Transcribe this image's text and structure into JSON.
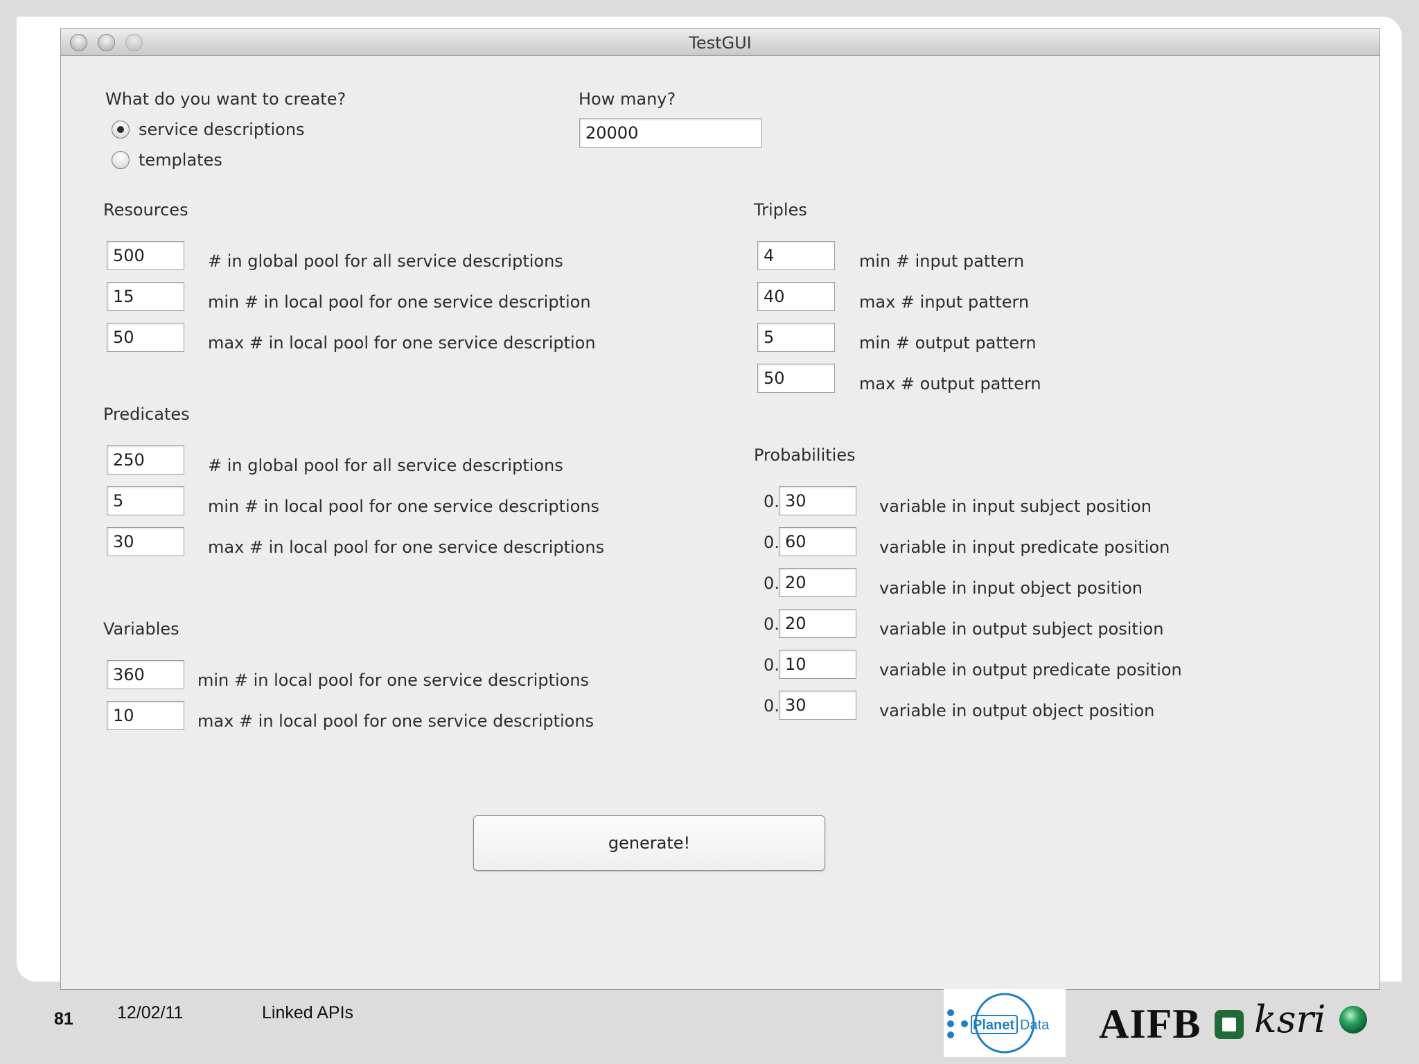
{
  "window": {
    "title": "TestGUI"
  },
  "create": {
    "question": "What do you want to create?",
    "options": [
      "service descriptions",
      "templates"
    ],
    "selected": "service descriptions"
  },
  "how_many": {
    "label": "How many?",
    "value": "20000"
  },
  "resources": {
    "title": "Resources",
    "rows": [
      {
        "value": "500",
        "label": "# in global pool for all service descriptions"
      },
      {
        "value": "15",
        "label": "min # in local pool for one service description"
      },
      {
        "value": "50",
        "label": "max # in local pool for one service description"
      }
    ]
  },
  "predicates": {
    "title": "Predicates",
    "rows": [
      {
        "value": "250",
        "label": "# in global pool for all service descriptions"
      },
      {
        "value": "5",
        "label": "min # in local pool for one service descriptions"
      },
      {
        "value": "30",
        "label": "max # in local pool for one service descriptions"
      }
    ]
  },
  "variables": {
    "title": "Variables",
    "rows": [
      {
        "value": "360",
        "label": "min # in local pool for one service descriptions"
      },
      {
        "value": "10",
        "label": "max # in local pool for one service descriptions"
      }
    ]
  },
  "triples": {
    "title": "Triples",
    "rows": [
      {
        "value": "4",
        "label": "min # input pattern"
      },
      {
        "value": "40",
        "label": "max # input pattern"
      },
      {
        "value": "5",
        "label": "min # output pattern"
      },
      {
        "value": "50",
        "label": "max # output pattern"
      }
    ]
  },
  "probabilities": {
    "title": "Probabilities",
    "prefix": "0.",
    "rows": [
      {
        "value": "30",
        "label": "variable in input subject position"
      },
      {
        "value": "60",
        "label": "variable in input predicate position"
      },
      {
        "value": "20",
        "label": "variable in input object position"
      },
      {
        "value": "20",
        "label": "variable in output subject position"
      },
      {
        "value": "10",
        "label": "variable in output predicate position"
      },
      {
        "value": "30",
        "label": "variable in output object position"
      }
    ]
  },
  "generate_button": "generate!",
  "footer": {
    "page_number": "81",
    "date": "12/02/11",
    "title": "Linked APIs",
    "logo_planet": "Planet",
    "logo_data": "Data",
    "logo_aifb": "AIFB",
    "logo_ksri": "ksri"
  },
  "colors": {
    "window_bg": "#ededee",
    "slide_bg": "#dcdcdc",
    "globe_green": "#1f8f4f"
  }
}
